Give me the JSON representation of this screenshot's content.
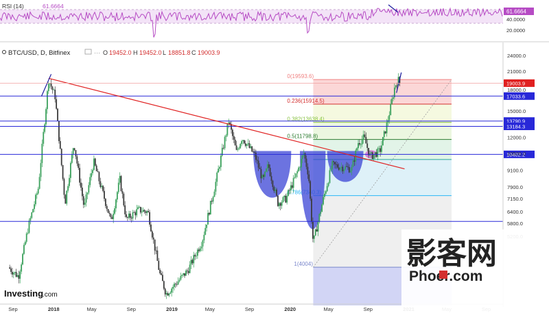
{
  "rsi_panel": {
    "label": "RSI (14)",
    "value": "61.6664",
    "value_tag": "61.6664",
    "ticks": [
      "40.0000",
      "20.0000"
    ],
    "level_upper": 70,
    "level_lower": 30
  },
  "header": {
    "symbol": "BTC/USD, D, Bitfinex",
    "o_label": "O",
    "o_value": "19452.0",
    "h_label": "H",
    "h_value": "19452.0",
    "l_label": "L",
    "l_value": "18851.8",
    "c_label": "C",
    "c_value": "19003.9"
  },
  "brand": {
    "logo_text": "Investing",
    "logo_suffix": ".com",
    "watermark_cn": "影客网",
    "watermark_en": "Phoer.com"
  },
  "colors": {
    "up": "#26a69a",
    "down": "#ef5350",
    "candle_up": "#3aa05b",
    "candle_down": "#3b3b3b",
    "hline": "#2828d8",
    "trendline": "#e02020",
    "rsi_line": "#b64bc4",
    "rsi_fill": "#f3e3f7"
  },
  "chart_data": {
    "type": "candlestick",
    "title": "BTC/USD, D, Bitfinex",
    "ohlc": {
      "open": 19452.0,
      "high": 19452.0,
      "low": 18851.8,
      "close": 19003.9
    },
    "y_scale": "log",
    "y_ticks": [
      24000,
      21000,
      18000,
      15000,
      12000,
      10500,
      9100,
      7900,
      7150,
      6400,
      5800,
      5200
    ],
    "y_tick_labels": [
      "24000.0",
      "21000.0",
      "18000.0",
      "15000.0",
      "12000.0",
      "10500.0",
      "9100.0",
      "7900.0",
      "7150.0",
      "6400.0",
      "5800.0",
      "5200.0"
    ],
    "x_tick_labels": [
      "Sep",
      "2018",
      "May",
      "Sep",
      "2019",
      "May",
      "Sep",
      "2020",
      "May",
      "Sep",
      "2021",
      "May",
      "Sep"
    ],
    "price_series": [
      [
        "2017-08-15",
        4000
      ],
      [
        "2017-09-15",
        3700
      ],
      [
        "2017-10-15",
        5600
      ],
      [
        "2017-11-15",
        7800
      ],
      [
        "2017-12-17",
        19600
      ],
      [
        "2018-01-06",
        17000
      ],
      [
        "2018-02-06",
        6900
      ],
      [
        "2018-03-05",
        11500
      ],
      [
        "2018-04-06",
        6600
      ],
      [
        "2018-05-05",
        9800
      ],
      [
        "2018-06-28",
        5900
      ],
      [
        "2018-07-25",
        8400
      ],
      [
        "2018-08-14",
        6000
      ],
      [
        "2018-09-20",
        6500
      ],
      [
        "2018-10-20",
        6400
      ],
      [
        "2018-11-25",
        3800
      ],
      [
        "2018-12-15",
        3200
      ],
      [
        "2019-01-20",
        3550
      ],
      [
        "2019-02-20",
        3900
      ],
      [
        "2019-04-05",
        5000
      ],
      [
        "2019-05-15",
        8000
      ],
      [
        "2019-06-26",
        13800
      ],
      [
        "2019-07-20",
        10600
      ],
      [
        "2019-08-06",
        12000
      ],
      [
        "2019-09-15",
        10300
      ],
      [
        "2019-10-10",
        8300
      ],
      [
        "2019-10-26",
        9500
      ],
      [
        "2019-11-25",
        6900
      ],
      [
        "2019-12-20",
        7150
      ],
      [
        "2020-01-20",
        8700
      ],
      [
        "2020-02-13",
        10500
      ],
      [
        "2020-02-28",
        8700
      ],
      [
        "2020-03-13",
        4900
      ],
      [
        "2020-04-10",
        6900
      ],
      [
        "2020-05-10",
        9500
      ],
      [
        "2020-06-20",
        9300
      ],
      [
        "2020-07-10",
        9200
      ],
      [
        "2020-07-30",
        11500
      ],
      [
        "2020-08-17",
        12000
      ],
      [
        "2020-09-05",
        10200
      ],
      [
        "2020-10-05",
        10700
      ],
      [
        "2020-10-25",
        13200
      ],
      [
        "2020-11-07",
        15500
      ],
      [
        "2020-11-20",
        18500
      ],
      [
        "2020-11-30",
        19600
      ],
      [
        "2020-12-05",
        19000
      ]
    ],
    "horizontal_lines": [
      17033.6,
      13790.9,
      13184.3,
      10402.2,
      5900
    ],
    "price_tags": [
      {
        "label": "19003.9",
        "value": 19003.9,
        "color": "#e02020"
      },
      {
        "label": "17033.6",
        "value": 17033.6,
        "color": "#2828d8"
      },
      {
        "label": "13790.9",
        "value": 13790.9,
        "color": "#2828d8"
      },
      {
        "label": "13184.3",
        "value": 13184.3,
        "color": "#2828d8"
      },
      {
        "label": "10402.2",
        "value": 10402.2,
        "color": "#2828d8"
      }
    ],
    "fibonacci": {
      "levels": [
        {
          "ratio": "0",
          "value": 19593.6,
          "label": "0(19593.6)",
          "color": "#f08080"
        },
        {
          "ratio": "0.236",
          "value": 15914.5,
          "label": "0.236(15914.5)",
          "color": "#d32f2f"
        },
        {
          "ratio": "0.382",
          "value": 13638.4,
          "label": "0.382(13638.4)",
          "color": "#8bc34a"
        },
        {
          "ratio": "0.5",
          "value": 11798.8,
          "label": "0.5(11798.8)",
          "color": "#2e7d32"
        },
        {
          "ratio": "0.618",
          "value": 9959.3,
          "label": "",
          "color": "#26a69a"
        },
        {
          "ratio": "0.786",
          "value": 7340.3,
          "label": "0.786(7340.3)",
          "color": "#29b6f6"
        },
        {
          "ratio": "1",
          "value": 4004,
          "label": "1(4004)",
          "color": "#7986cb"
        }
      ]
    },
    "trendline": {
      "from": [
        "2017-12-17",
        19800
      ],
      "to": [
        "2020-12-20",
        9200
      ]
    },
    "annotations": [
      "cup-and-handle",
      "inverse-head-and-shoulders"
    ]
  }
}
